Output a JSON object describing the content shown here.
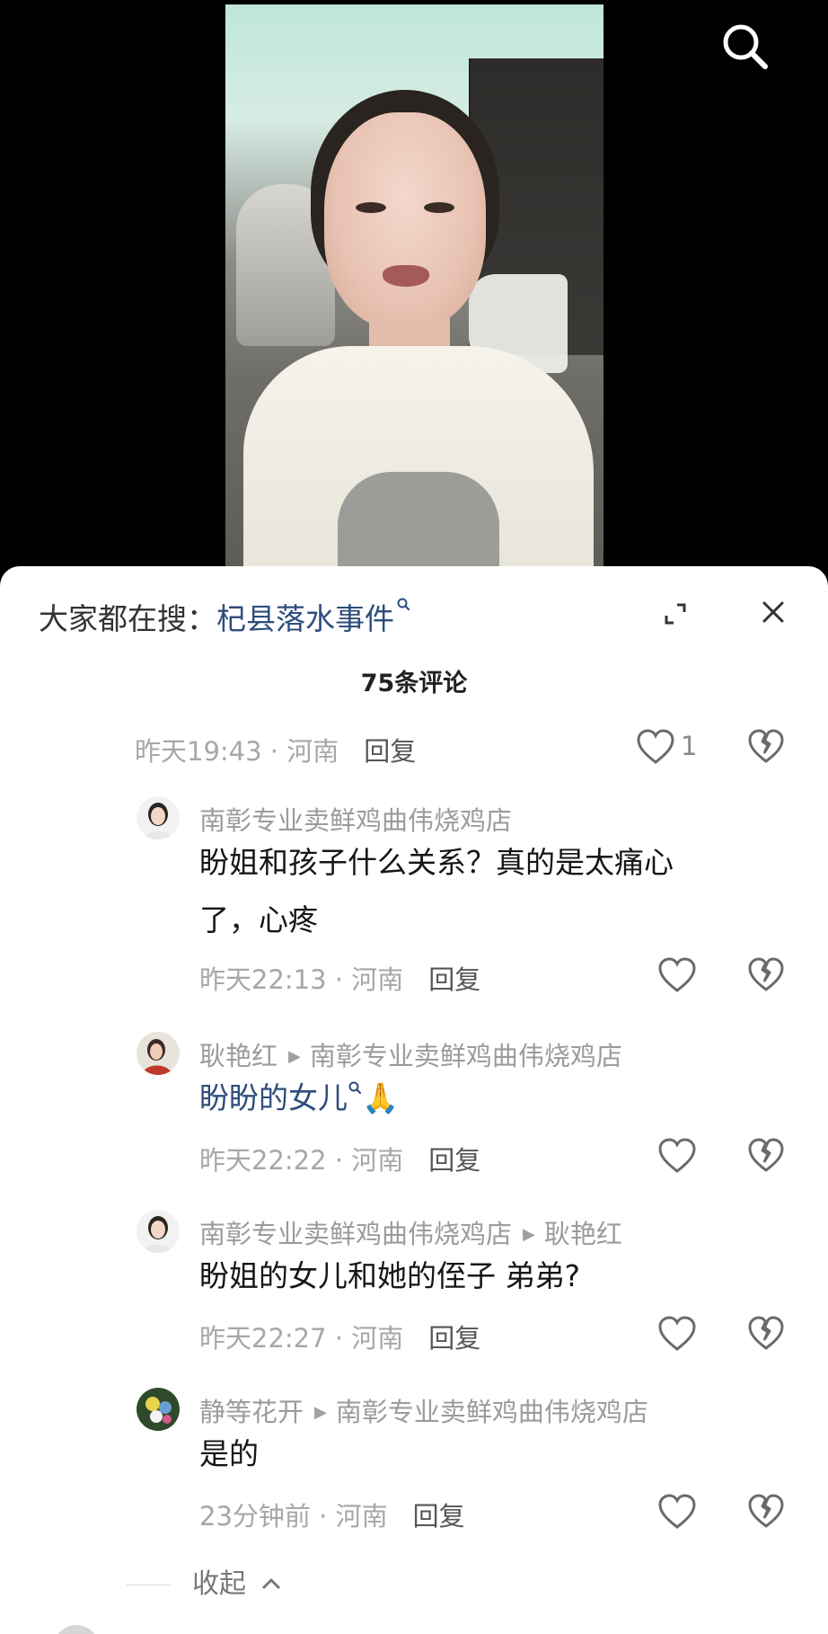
{
  "trending": {
    "prefix": "大家都在搜：",
    "keyword": "杞县落水事件"
  },
  "comment_count": "75条评论",
  "parent_meta": {
    "time": "昨天19:43",
    "sep": " · ",
    "location": "河南",
    "reply": "回复",
    "likes": "1"
  },
  "replies": [
    {
      "author": "南彰专业卖鲜鸡曲伟烧鸡店",
      "target": "",
      "text_line1": "盼姐和孩子什么关系？真的是太痛心",
      "text_line2": "了，心疼",
      "time": "昨天22:13",
      "location": "河南",
      "reply": "回复"
    },
    {
      "author": "耿艳红",
      "target": "南彰专业卖鲜鸡曲伟烧鸡店",
      "text_keyword": "盼盼的女儿",
      "text_emoji": "🙏",
      "time": "昨天22:22",
      "location": "河南",
      "reply": "回复"
    },
    {
      "author": "南彰专业卖鲜鸡曲伟烧鸡店",
      "target": "耿艳红",
      "text": "盼姐的女儿和她的侄子 弟弟?",
      "time": "昨天22:27",
      "location": "河南",
      "reply": "回复"
    },
    {
      "author": "静等花开",
      "target": "南彰专业卖鲜鸡曲伟烧鸡店",
      "text": "是的",
      "time": "23分钟前",
      "location": "河南",
      "reply": "回复"
    }
  ],
  "collapse_label": "收起",
  "icons": {
    "search": "search-icon",
    "expand": "expand-icon",
    "close": "close-icon",
    "like": "heart-icon",
    "dislike": "broken-heart-icon",
    "collapse": "chevron-up-icon"
  },
  "colors": {
    "keyword": "#2e4d7c",
    "meta": "#a7a7a7",
    "panel": "#ffffff"
  }
}
